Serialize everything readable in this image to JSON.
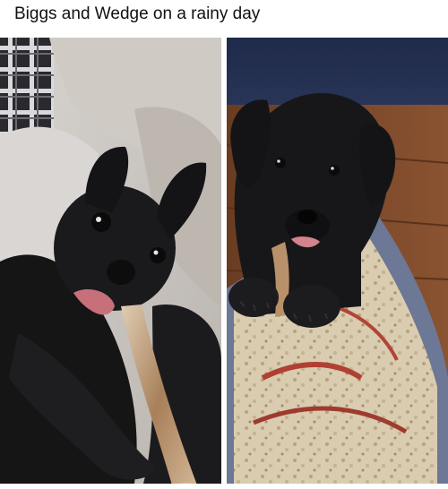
{
  "post": {
    "caption": "Biggs and Wedge on a rainy day"
  },
  "photos": [
    {
      "subject": "black puppy chewing a bully stick on a blanket"
    },
    {
      "subject": "black puppy chewing a bully stick on a rug"
    }
  ]
}
